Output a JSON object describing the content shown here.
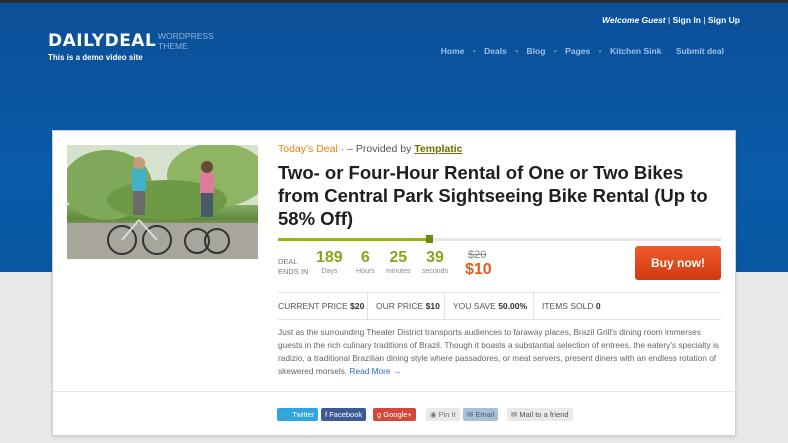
{
  "header": {
    "logo": "DAILYDEAL",
    "logo_sub": "WORDPRESS THEME",
    "tagline": "This is a demo video site",
    "welcome": "Welcome Guest",
    "sign_in": "Sign In",
    "sign_up": "Sign Up",
    "nav": [
      "Home",
      "Deals",
      "Blog",
      "Pages",
      "Kitchen Sink",
      "Submit deal"
    ]
  },
  "deal": {
    "today_label": "Today's Deal",
    "provided_by": "– Provided by",
    "provider": "Templatic",
    "title": "Two- or Four-Hour Rental of One or Two Bikes from Central Park Sightseeing Bike Rental (Up to 58% Off)",
    "progress_fraction": 0.34,
    "deal_ends": "DEAL ENDS IN",
    "countdown": {
      "days": "189",
      "days_label": "Days",
      "hours": "6",
      "hours_label": "Hours",
      "minutes": "25",
      "minutes_label": "minutes",
      "seconds": "39",
      "seconds_label": "seconds"
    },
    "old_price": "$20",
    "new_price": "$10",
    "buy_label": "Buy now!",
    "stats": {
      "current_price_label": "CURRENT PRICE",
      "current_price": "$20",
      "our_price_label": "OUR PRICE",
      "our_price": "$10",
      "you_save_label": "YOU SAVE",
      "you_save": "50.00%",
      "items_sold_label": "ITEMS SOLD",
      "items_sold": "0"
    },
    "description": "Just as the surrounding Theater District transports audiences to faraway places, Brazil Grill's dining room immerses guests in the rich culinary traditions of Brazil. Though it boasts a substantial selection of entrees, the eatery's specialty is radizio, a traditional Brazilian dining style where passadores, or meat servers, present diners with an endless rotation of skewered morsels.",
    "read_more": "Read More →"
  },
  "share": {
    "twitter": "Twitter",
    "facebook": "Facebook",
    "google": "Google+",
    "pin": "Pin It",
    "email": "Email",
    "mail_friend": "Mail to a friend"
  },
  "colors": {
    "header_blue": "#0b5aa8",
    "accent_orange": "#e8800a",
    "countdown_green": "#85a81a",
    "buy_button": "#e04a1c"
  }
}
